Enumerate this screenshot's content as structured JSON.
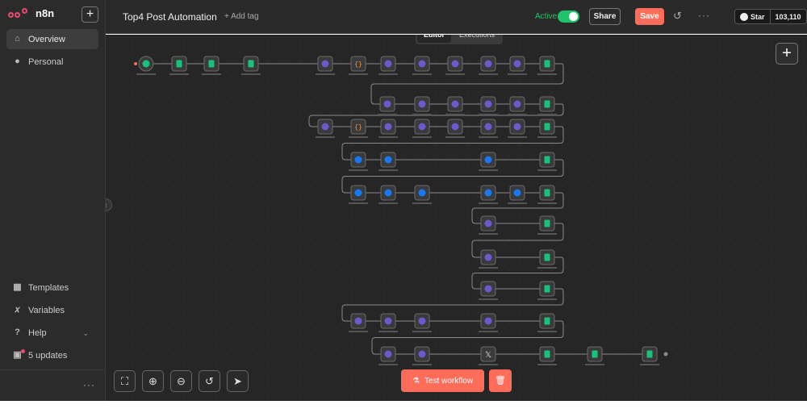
{
  "app": {
    "name": "n8n"
  },
  "sidebar": {
    "new_label": "+",
    "items": [
      {
        "label": "Overview",
        "icon": "home-icon"
      },
      {
        "label": "Personal",
        "icon": "user-icon"
      },
      {
        "label": "Templates",
        "icon": "templates-icon"
      },
      {
        "label": "Variables",
        "icon": "variables-icon"
      },
      {
        "label": "Help",
        "icon": "help-icon"
      },
      {
        "label": "5 updates",
        "icon": "gift-icon"
      }
    ],
    "more_label": "···"
  },
  "header": {
    "workflow_title": "Top4 Post Automation",
    "add_tag": "+ Add tag",
    "active_label": "Active",
    "active": true,
    "share_label": "Share",
    "save_label": "Save",
    "github": {
      "star_label": "Star",
      "count": "103,110"
    }
  },
  "canvas": {
    "tabs": [
      {
        "label": "Editor",
        "active": true
      },
      {
        "label": "Executions",
        "active": false
      }
    ],
    "test_workflow_label": "Test workflow"
  },
  "colors": {
    "accent": "#ff6d5a",
    "active_green": "#21c36a",
    "node_purple": "#6a5acd",
    "node_green": "#19c27a",
    "node_blue": "#1877f2"
  },
  "workflow_nodes": [
    {
      "kind": "trigger",
      "label": "Schedule Trigger"
    },
    {
      "kind": "sheets",
      "label": "get_draft"
    },
    {
      "kind": "sheets",
      "label": "many_draft"
    },
    {
      "kind": "sheets",
      "label": "Google Sheets"
    },
    {
      "kind": "http",
      "label": "get_content_draft"
    },
    {
      "kind": "code",
      "label": "clean_content_draft"
    },
    {
      "kind": "http",
      "label": "get_wp_image"
    },
    {
      "kind": "http",
      "label": "upload_wp_image"
    },
    {
      "kind": "http",
      "label": "set_wp_image_alt"
    },
    {
      "kind": "http",
      "label": "create_wp_post"
    },
    {
      "kind": "http",
      "label": "set_featured_image"
    },
    {
      "kind": "sheets",
      "label": "update_wp_url"
    },
    {
      "kind": "facebook",
      "label": "get_page_access_token"
    },
    {
      "kind": "facebook",
      "label": "create_fb_post"
    },
    {
      "kind": "x",
      "label": "create_x_post"
    },
    {
      "kind": "sheets",
      "label": "update_scheduled_status"
    },
    {
      "kind": "sheets",
      "label": "remove_draft"
    }
  ]
}
